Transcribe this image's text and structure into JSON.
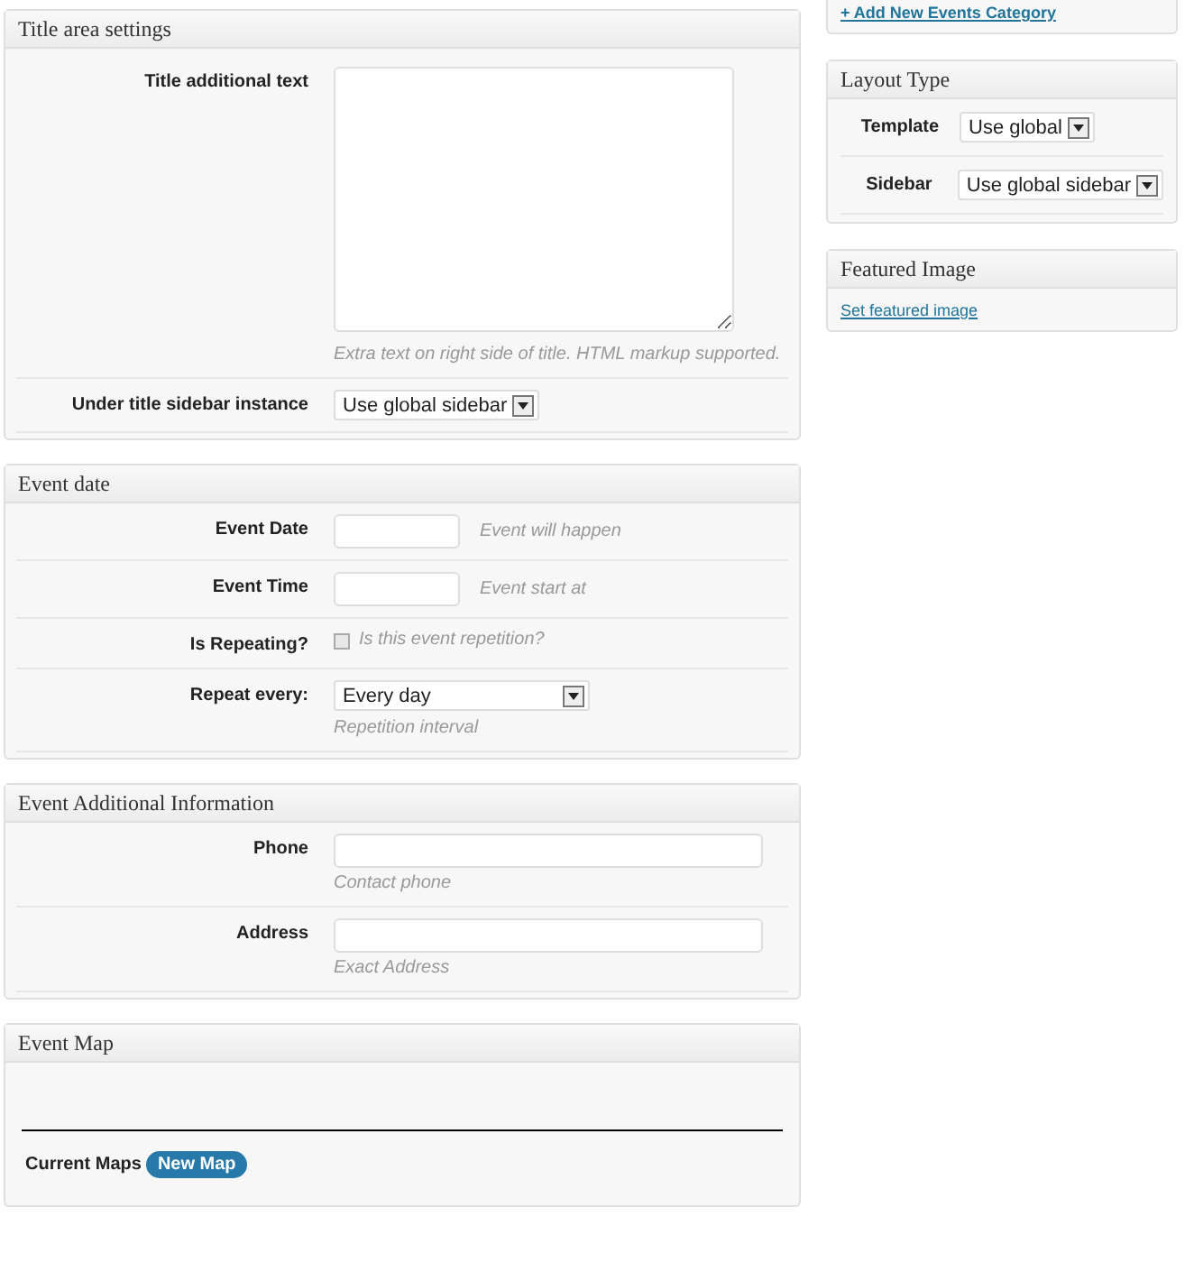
{
  "main_panels": [
    {
      "title": "Title area settings",
      "rows": [
        {
          "kind": "textarea",
          "label": "Title additional text",
          "hint": "Extra text on right side of title. HTML markup supported."
        },
        {
          "kind": "select",
          "label": "Under title sidebar instance",
          "value": "Use global sidebar"
        }
      ]
    },
    {
      "title": "Event date",
      "rows": [
        {
          "kind": "short_input",
          "label": "Event Date",
          "hint": "Event will happen"
        },
        {
          "kind": "short_input",
          "label": "Event Time",
          "hint": "Event start at"
        },
        {
          "kind": "checkbox",
          "label": "Is Repeating?",
          "text": "Is this event repetition?",
          "checked": false
        },
        {
          "kind": "wide_select",
          "label": "Repeat every:",
          "value": "Every day",
          "hint": "Repetition interval"
        }
      ]
    },
    {
      "title": "Event Additional Information",
      "rows": [
        {
          "kind": "input",
          "label": "Phone",
          "hint": "Contact phone"
        },
        {
          "kind": "input",
          "label": "Address",
          "hint": "Exact Address"
        }
      ]
    },
    {
      "title": "Event Map",
      "rows": [
        {
          "kind": "map",
          "label": "Current Maps",
          "button": "New Map"
        }
      ]
    }
  ],
  "side": {
    "category_link": "+ Add New Events Category",
    "layout": {
      "title": "Layout Type",
      "rows": [
        {
          "label": "Template",
          "value": "Use global"
        },
        {
          "label": "Sidebar",
          "value": "Use global sidebar"
        }
      ]
    },
    "featured": {
      "title": "Featured Image",
      "link": "Set featured image"
    }
  }
}
